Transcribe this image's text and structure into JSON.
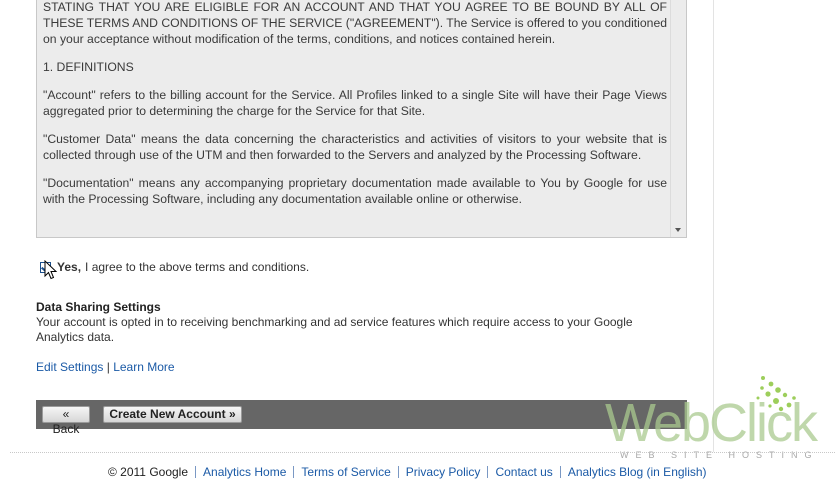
{
  "terms": {
    "paragraphs": [
      "STATING THAT YOU ARE ELIGIBLE FOR AN ACCOUNT AND THAT YOU AGREE TO BE BOUND BY ALL OF THESE TERMS AND CONDITIONS OF THE SERVICE (\"AGREEMENT\"). The Service is offered to you conditioned on your acceptance without modification of the terms, conditions, and notices contained herein.",
      "1. DEFINITIONS",
      "\"Account\" refers to the billing account for the Service. All Profiles linked to a single Site will have their Page Views aggregated prior to determining the charge for the Service for that Site.",
      "\"Customer Data\" means the data concerning the characteristics and activities of visitors to your website that is collected through use of the UTM and then forwarded to the Servers and analyzed by the Processing Software.",
      "\"Documentation\" means any accompanying proprietary documentation made available to You by Google for use with the Processing Software, including any documentation available online or otherwise."
    ]
  },
  "agreement": {
    "yes_label": "Yes,",
    "text": "I agree to the above terms and conditions.",
    "checked": true
  },
  "data_sharing": {
    "title": "Data Sharing Settings",
    "description": "Your account is opted in to receiving benchmarking and ad service features which require access to your Google Analytics data.",
    "edit_link": "Edit Settings",
    "separator": "|",
    "learn_more_link": "Learn More"
  },
  "actions": {
    "back_label": "« Back",
    "create_label": "Create New Account »"
  },
  "footer": {
    "copyright": "© 2011 Google",
    "links": [
      "Analytics Home",
      "Terms of Service",
      "Privacy Policy",
      "Contact us",
      "Analytics Blog (in English)"
    ]
  },
  "watermark": {
    "brand": "WebClick",
    "tagline": "WEB SITE HOSTING"
  },
  "colors": {
    "link": "#1b5aa6",
    "action_bar": "#666666",
    "logo_green": "#8cc63f"
  }
}
